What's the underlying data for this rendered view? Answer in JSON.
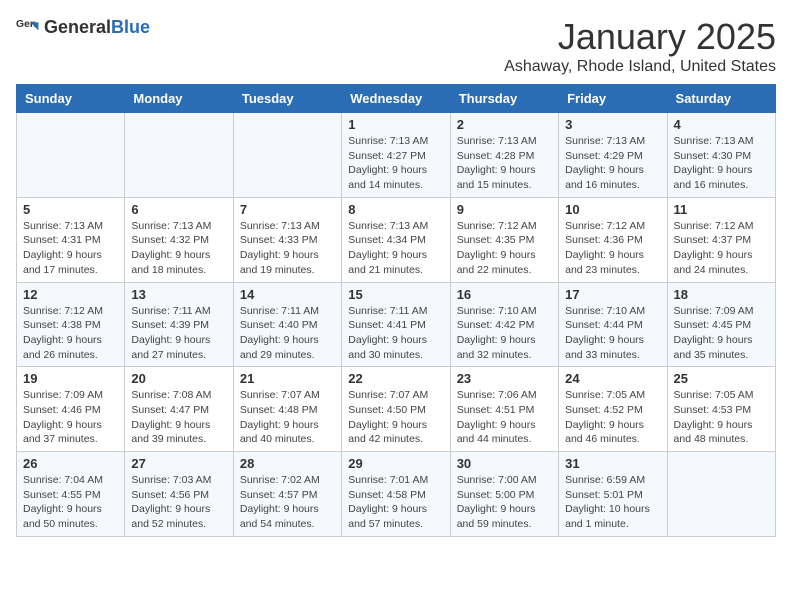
{
  "header": {
    "logo_general": "General",
    "logo_blue": "Blue",
    "title": "January 2025",
    "subtitle": "Ashaway, Rhode Island, United States"
  },
  "weekdays": [
    "Sunday",
    "Monday",
    "Tuesday",
    "Wednesday",
    "Thursday",
    "Friday",
    "Saturday"
  ],
  "weeks": [
    [
      {
        "day": "",
        "info": ""
      },
      {
        "day": "",
        "info": ""
      },
      {
        "day": "",
        "info": ""
      },
      {
        "day": "1",
        "info": "Sunrise: 7:13 AM\nSunset: 4:27 PM\nDaylight: 9 hours\nand 14 minutes."
      },
      {
        "day": "2",
        "info": "Sunrise: 7:13 AM\nSunset: 4:28 PM\nDaylight: 9 hours\nand 15 minutes."
      },
      {
        "day": "3",
        "info": "Sunrise: 7:13 AM\nSunset: 4:29 PM\nDaylight: 9 hours\nand 16 minutes."
      },
      {
        "day": "4",
        "info": "Sunrise: 7:13 AM\nSunset: 4:30 PM\nDaylight: 9 hours\nand 16 minutes."
      }
    ],
    [
      {
        "day": "5",
        "info": "Sunrise: 7:13 AM\nSunset: 4:31 PM\nDaylight: 9 hours\nand 17 minutes."
      },
      {
        "day": "6",
        "info": "Sunrise: 7:13 AM\nSunset: 4:32 PM\nDaylight: 9 hours\nand 18 minutes."
      },
      {
        "day": "7",
        "info": "Sunrise: 7:13 AM\nSunset: 4:33 PM\nDaylight: 9 hours\nand 19 minutes."
      },
      {
        "day": "8",
        "info": "Sunrise: 7:13 AM\nSunset: 4:34 PM\nDaylight: 9 hours\nand 21 minutes."
      },
      {
        "day": "9",
        "info": "Sunrise: 7:12 AM\nSunset: 4:35 PM\nDaylight: 9 hours\nand 22 minutes."
      },
      {
        "day": "10",
        "info": "Sunrise: 7:12 AM\nSunset: 4:36 PM\nDaylight: 9 hours\nand 23 minutes."
      },
      {
        "day": "11",
        "info": "Sunrise: 7:12 AM\nSunset: 4:37 PM\nDaylight: 9 hours\nand 24 minutes."
      }
    ],
    [
      {
        "day": "12",
        "info": "Sunrise: 7:12 AM\nSunset: 4:38 PM\nDaylight: 9 hours\nand 26 minutes."
      },
      {
        "day": "13",
        "info": "Sunrise: 7:11 AM\nSunset: 4:39 PM\nDaylight: 9 hours\nand 27 minutes."
      },
      {
        "day": "14",
        "info": "Sunrise: 7:11 AM\nSunset: 4:40 PM\nDaylight: 9 hours\nand 29 minutes."
      },
      {
        "day": "15",
        "info": "Sunrise: 7:11 AM\nSunset: 4:41 PM\nDaylight: 9 hours\nand 30 minutes."
      },
      {
        "day": "16",
        "info": "Sunrise: 7:10 AM\nSunset: 4:42 PM\nDaylight: 9 hours\nand 32 minutes."
      },
      {
        "day": "17",
        "info": "Sunrise: 7:10 AM\nSunset: 4:44 PM\nDaylight: 9 hours\nand 33 minutes."
      },
      {
        "day": "18",
        "info": "Sunrise: 7:09 AM\nSunset: 4:45 PM\nDaylight: 9 hours\nand 35 minutes."
      }
    ],
    [
      {
        "day": "19",
        "info": "Sunrise: 7:09 AM\nSunset: 4:46 PM\nDaylight: 9 hours\nand 37 minutes."
      },
      {
        "day": "20",
        "info": "Sunrise: 7:08 AM\nSunset: 4:47 PM\nDaylight: 9 hours\nand 39 minutes."
      },
      {
        "day": "21",
        "info": "Sunrise: 7:07 AM\nSunset: 4:48 PM\nDaylight: 9 hours\nand 40 minutes."
      },
      {
        "day": "22",
        "info": "Sunrise: 7:07 AM\nSunset: 4:50 PM\nDaylight: 9 hours\nand 42 minutes."
      },
      {
        "day": "23",
        "info": "Sunrise: 7:06 AM\nSunset: 4:51 PM\nDaylight: 9 hours\nand 44 minutes."
      },
      {
        "day": "24",
        "info": "Sunrise: 7:05 AM\nSunset: 4:52 PM\nDaylight: 9 hours\nand 46 minutes."
      },
      {
        "day": "25",
        "info": "Sunrise: 7:05 AM\nSunset: 4:53 PM\nDaylight: 9 hours\nand 48 minutes."
      }
    ],
    [
      {
        "day": "26",
        "info": "Sunrise: 7:04 AM\nSunset: 4:55 PM\nDaylight: 9 hours\nand 50 minutes."
      },
      {
        "day": "27",
        "info": "Sunrise: 7:03 AM\nSunset: 4:56 PM\nDaylight: 9 hours\nand 52 minutes."
      },
      {
        "day": "28",
        "info": "Sunrise: 7:02 AM\nSunset: 4:57 PM\nDaylight: 9 hours\nand 54 minutes."
      },
      {
        "day": "29",
        "info": "Sunrise: 7:01 AM\nSunset: 4:58 PM\nDaylight: 9 hours\nand 57 minutes."
      },
      {
        "day": "30",
        "info": "Sunrise: 7:00 AM\nSunset: 5:00 PM\nDaylight: 9 hours\nand 59 minutes."
      },
      {
        "day": "31",
        "info": "Sunrise: 6:59 AM\nSunset: 5:01 PM\nDaylight: 10 hours\nand 1 minute."
      },
      {
        "day": "",
        "info": ""
      }
    ]
  ]
}
